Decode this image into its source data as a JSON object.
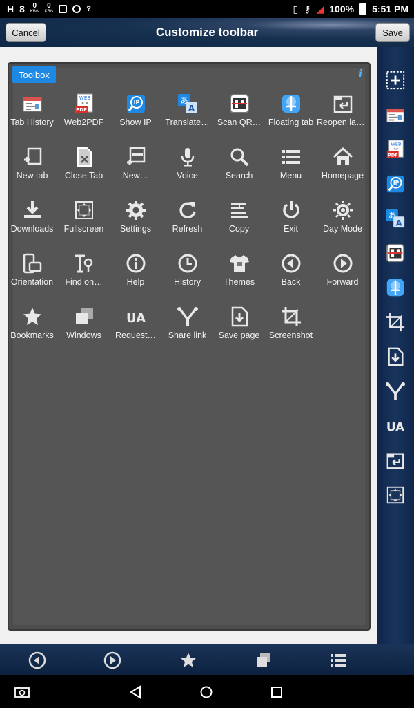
{
  "status_bar": {
    "network_type": "H",
    "speed_up_value": "0",
    "speed_up_unit": "KB/s",
    "speed_down_value": "0",
    "speed_down_unit": "KB/s",
    "signal_unknown": "?",
    "battery": "100%",
    "time": "5:51 PM"
  },
  "header": {
    "title": "Customize toolbar",
    "cancel_label": "Cancel",
    "save_label": "Save"
  },
  "toolbox": {
    "tab_label": "Toolbox",
    "info_glyph": "i",
    "items": [
      {
        "label": "Tab History",
        "icon": "tab-history-icon"
      },
      {
        "label": "Web2PDF",
        "icon": "pdf-icon"
      },
      {
        "label": "Show IP",
        "icon": "show-ip-icon"
      },
      {
        "label": "Translate…",
        "icon": "translate-icon"
      },
      {
        "label": "Scan QR…",
        "icon": "qr-icon"
      },
      {
        "label": "Floating tab",
        "icon": "floating-tab-icon"
      },
      {
        "label": "Reopen las…",
        "icon": "reopen-icon"
      },
      {
        "label": "New tab",
        "icon": "new-tab-icon"
      },
      {
        "label": "Close Tab",
        "icon": "close-tab-icon"
      },
      {
        "label": "New…",
        "icon": "incognito-icon"
      },
      {
        "label": "Voice",
        "icon": "microphone-icon"
      },
      {
        "label": "Search",
        "icon": "search-icon"
      },
      {
        "label": "Menu",
        "icon": "menu-icon"
      },
      {
        "label": "Homepage",
        "icon": "home-icon"
      },
      {
        "label": "Downloads",
        "icon": "download-icon"
      },
      {
        "label": "Fullscreen",
        "icon": "fullscreen-icon"
      },
      {
        "label": "Settings",
        "icon": "gear-icon"
      },
      {
        "label": "Refresh",
        "icon": "refresh-icon"
      },
      {
        "label": "Copy",
        "icon": "copy-icon"
      },
      {
        "label": "Exit",
        "icon": "power-icon"
      },
      {
        "label": "Day Mode",
        "icon": "day-mode-icon"
      },
      {
        "label": "Orientation",
        "icon": "orientation-icon"
      },
      {
        "label": "Find on…",
        "icon": "find-icon"
      },
      {
        "label": "Help",
        "icon": "info-icon"
      },
      {
        "label": "History",
        "icon": "clock-icon"
      },
      {
        "label": "Themes",
        "icon": "shirt-icon"
      },
      {
        "label": "Back",
        "icon": "back-icon"
      },
      {
        "label": "Forward",
        "icon": "forward-icon"
      },
      {
        "label": "Bookmarks",
        "icon": "star-icon"
      },
      {
        "label": "Windows",
        "icon": "windows-icon"
      },
      {
        "label": "Request…",
        "icon": "ua-icon"
      },
      {
        "label": "Share link",
        "icon": "share-icon"
      },
      {
        "label": "Save page",
        "icon": "save-page-icon"
      },
      {
        "label": "Screenshot",
        "icon": "crop-icon"
      }
    ]
  },
  "toolbar_right": {
    "ua_text": "UA",
    "items": [
      "add-icon",
      "tab-history-icon",
      "pdf-icon",
      "show-ip-icon",
      "translate-icon",
      "qr-icon",
      "floating-tab-icon",
      "crop-icon",
      "save-page-icon",
      "share-icon",
      "ua-icon",
      "reopen-icon",
      "fullscreen-icon"
    ]
  },
  "bottom_bar": {
    "items": [
      "back-icon",
      "forward-icon",
      "star-icon",
      "windows-icon",
      "menu-icon"
    ]
  },
  "nav_bar": {
    "items": [
      "screenshot-icon",
      "back-triangle-icon",
      "home-circle-icon",
      "recents-square-icon"
    ]
  },
  "colors": {
    "accent": "#1e88e5",
    "panel": "#555555",
    "header": "#16304f"
  }
}
